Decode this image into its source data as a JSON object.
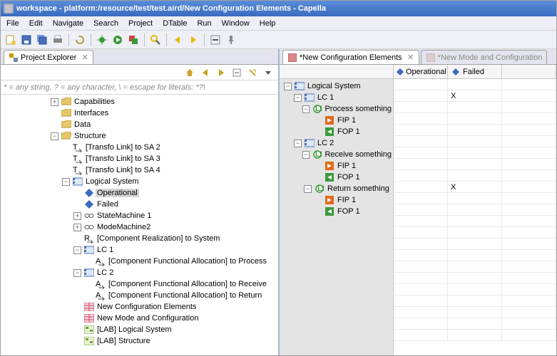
{
  "title": "workspace - platform:/resource/test/test.aird/New Configuration Elements - Capella",
  "menu": {
    "file": "File",
    "edit": "Edit",
    "navigate": "Navigate",
    "search": "Search",
    "project": "Project",
    "dtable": "DTable",
    "run": "Run",
    "window": "Window",
    "help": "Help"
  },
  "explorer": {
    "tabLabel": "Project Explorer",
    "filterHint": "* = any string, ? = any character, \\ = escape for literals: *?\\",
    "tree": [
      {
        "d": 3,
        "tw": "+",
        "ic": "folder",
        "label": "Capabilities"
      },
      {
        "d": 3,
        "tw": "",
        "ic": "folder",
        "label": "Interfaces"
      },
      {
        "d": 3,
        "tw": "",
        "ic": "folder",
        "label": "Data"
      },
      {
        "d": 3,
        "tw": "-",
        "ic": "folder-open",
        "label": "Structure"
      },
      {
        "d": 4,
        "tw": "",
        "ic": "transfo",
        "label": "[Transfo Link] to SA 2"
      },
      {
        "d": 4,
        "tw": "",
        "ic": "transfo",
        "label": "[Transfo Link] to SA 3"
      },
      {
        "d": 4,
        "tw": "",
        "ic": "transfo",
        "label": "[Transfo Link] to SA 4"
      },
      {
        "d": 4,
        "tw": "-",
        "ic": "lc",
        "label": "Logical System"
      },
      {
        "d": 5,
        "tw": "",
        "ic": "cs-blue",
        "label": "Operational",
        "sel": true
      },
      {
        "d": 5,
        "tw": "",
        "ic": "cs-blue",
        "label": "Failed"
      },
      {
        "d": 5,
        "tw": "+",
        "ic": "sm",
        "label": "StateMachine 1"
      },
      {
        "d": 5,
        "tw": "+",
        "ic": "sm",
        "label": "ModeMachine2"
      },
      {
        "d": 5,
        "tw": "",
        "ic": "realize",
        "label": "[Component Realization] to System"
      },
      {
        "d": 5,
        "tw": "-",
        "ic": "lc",
        "label": "LC 1"
      },
      {
        "d": 6,
        "tw": "",
        "ic": "alloc",
        "label": "[Component Functional Allocation] to Process"
      },
      {
        "d": 5,
        "tw": "-",
        "ic": "lc",
        "label": "LC 2"
      },
      {
        "d": 6,
        "tw": "",
        "ic": "alloc",
        "label": "[Component Functional Allocation] to Receive"
      },
      {
        "d": 6,
        "tw": "",
        "ic": "alloc",
        "label": "[Component Functional Allocation] to Return"
      },
      {
        "d": 5,
        "tw": "",
        "ic": "table",
        "label": "New Configuration Elements"
      },
      {
        "d": 5,
        "tw": "",
        "ic": "table",
        "label": "New Mode and Configuration"
      },
      {
        "d": 5,
        "tw": "",
        "ic": "diagram",
        "label": "[LAB] Logical System"
      },
      {
        "d": 5,
        "tw": "",
        "ic": "diagram",
        "label": "[LAB] Structure"
      }
    ]
  },
  "editor": {
    "activeTab": "*New Configuration Elements",
    "inactiveTab": "*New Mode and Configuration",
    "columns": [
      "Operational",
      "Failed"
    ],
    "rows": [
      {
        "d": 0,
        "tw": "-",
        "ic": "lc",
        "label": "Logical System",
        "vals": [
          "",
          ""
        ]
      },
      {
        "d": 1,
        "tw": "-",
        "ic": "lc",
        "label": "LC 1",
        "vals": [
          "",
          "X"
        ]
      },
      {
        "d": 2,
        "tw": "-",
        "ic": "lf",
        "label": "Process something",
        "vals": [
          "",
          ""
        ]
      },
      {
        "d": 3,
        "tw": "",
        "ic": "fip",
        "label": "FIP 1",
        "vals": [
          "",
          ""
        ]
      },
      {
        "d": 3,
        "tw": "",
        "ic": "fop",
        "label": "FOP 1",
        "vals": [
          "",
          ""
        ]
      },
      {
        "d": 1,
        "tw": "-",
        "ic": "lc",
        "label": "LC 2",
        "vals": [
          "",
          ""
        ]
      },
      {
        "d": 2,
        "tw": "-",
        "ic": "lf",
        "label": "Receive something",
        "vals": [
          "",
          ""
        ]
      },
      {
        "d": 3,
        "tw": "",
        "ic": "fip",
        "label": "FIP 1",
        "vals": [
          "",
          ""
        ]
      },
      {
        "d": 3,
        "tw": "",
        "ic": "fop",
        "label": "FOP 1",
        "vals": [
          "",
          ""
        ]
      },
      {
        "d": 2,
        "tw": "-",
        "ic": "lf",
        "label": "Return something",
        "vals": [
          "",
          "X"
        ]
      },
      {
        "d": 3,
        "tw": "",
        "ic": "fip",
        "label": "FIP 1",
        "vals": [
          "",
          ""
        ]
      },
      {
        "d": 3,
        "tw": "",
        "ic": "fop",
        "label": "FOP 1",
        "vals": [
          "",
          ""
        ]
      }
    ]
  }
}
